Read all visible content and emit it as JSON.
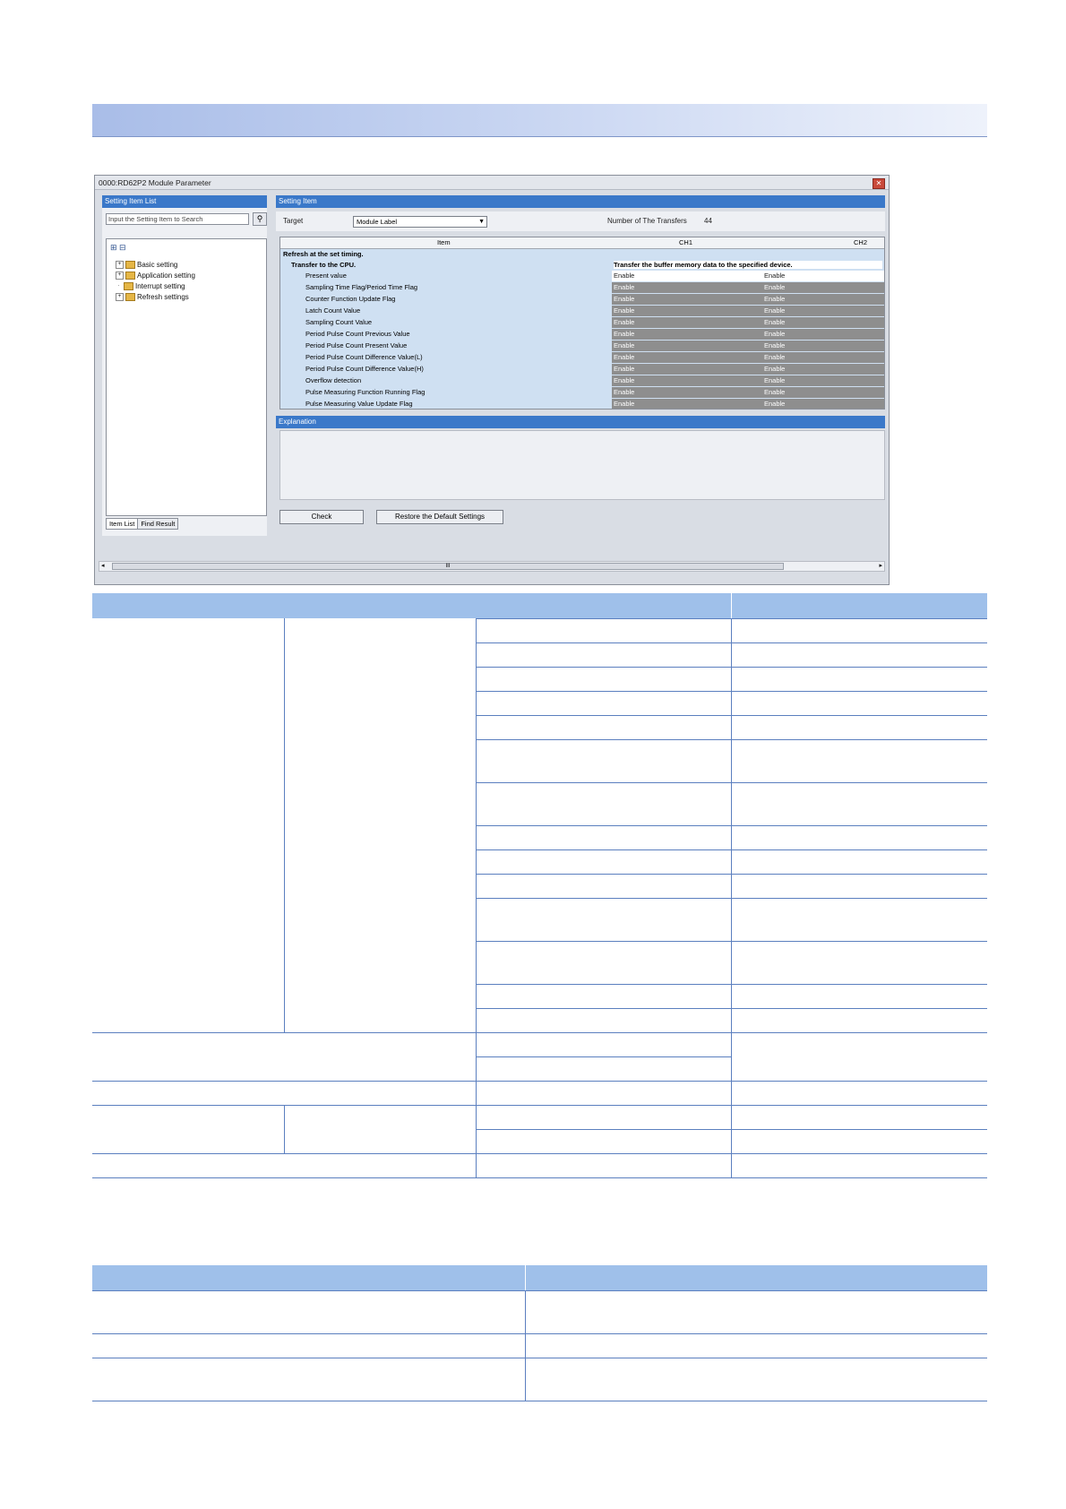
{
  "window": {
    "title": "0000:RD62P2 Module Parameter",
    "left_panel_title": "Setting Item List",
    "search_placeholder": "Input the Setting Item to Search",
    "tree": [
      "Basic setting",
      "Application setting",
      "Interrupt setting",
      "Refresh settings"
    ],
    "tabs": [
      "Item List",
      "Find Result"
    ],
    "right_panel_title": "Setting Item",
    "target_label": "Target",
    "target_value": "Module Label",
    "transfers_label": "Number of The Transfers",
    "transfers_value": "44",
    "grid": {
      "headers": [
        "Item",
        "CH1",
        "CH2"
      ],
      "group1": "Refresh at the set timing.",
      "group2": "Transfer to the CPU.",
      "group2_note": "Transfer the buffer memory data to the specified device.",
      "rows": [
        {
          "name": "Present value",
          "ch1": "Enable",
          "ch2": "Enable"
        },
        {
          "name": "Sampling Time Flag/Period Time Flag",
          "ch1": "Enable",
          "ch2": "Enable"
        },
        {
          "name": "Counter Function Update Flag",
          "ch1": "Enable",
          "ch2": "Enable"
        },
        {
          "name": "Latch Count Value",
          "ch1": "Enable",
          "ch2": "Enable"
        },
        {
          "name": "Sampling Count Value",
          "ch1": "Enable",
          "ch2": "Enable"
        },
        {
          "name": "Period Pulse Count Previous Value",
          "ch1": "Enable",
          "ch2": "Enable"
        },
        {
          "name": "Period Pulse Count Present Value",
          "ch1": "Enable",
          "ch2": "Enable"
        },
        {
          "name": "Period Pulse Count Difference Value(L)",
          "ch1": "Enable",
          "ch2": "Enable"
        },
        {
          "name": "Period Pulse Count Difference Value(H)",
          "ch1": "Enable",
          "ch2": "Enable"
        },
        {
          "name": "Overflow detection",
          "ch1": "Enable",
          "ch2": "Enable"
        },
        {
          "name": "Pulse Measuring Function Running Flag",
          "ch1": "Enable",
          "ch2": "Enable"
        },
        {
          "name": "Pulse Measuring Value Update Flag",
          "ch1": "Enable",
          "ch2": "Enable"
        }
      ]
    },
    "explanation_title": "Explanation",
    "buttons": {
      "check": "Check",
      "restore": "Restore the Default Settings"
    },
    "scroll_mark": "III"
  },
  "colors": {
    "accent": "#3a78c9",
    "table_header": "#9fc0ea",
    "rule": "#5b7fbf"
  }
}
